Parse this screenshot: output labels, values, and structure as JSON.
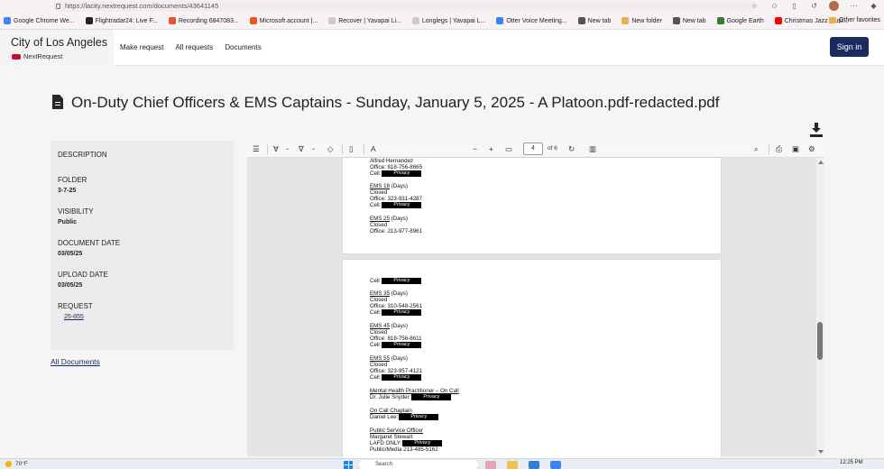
{
  "browser": {
    "url": "https://lacity.nextrequest.com/documents/43641145",
    "bookmarks": [
      {
        "label": "Google Chrome We...",
        "color": "#4285f4"
      },
      {
        "label": "Flightradar24: Live F...",
        "color": "#222222"
      },
      {
        "label": "Recording 6847083...",
        "color": "#e8542f"
      },
      {
        "label": "Microsoft account |...",
        "color": "#f25022"
      },
      {
        "label": "Recover | Yavapai Li...",
        "color": "#cccccc"
      },
      {
        "label": "Longlegs | Yavapai L...",
        "color": "#cccccc"
      },
      {
        "label": "Otter Voice Meeting...",
        "color": "#3b82f6"
      },
      {
        "label": "New tab",
        "color": "#555555"
      },
      {
        "label": "New folder",
        "color": "#e8b04a"
      },
      {
        "label": "New tab",
        "color": "#555555"
      },
      {
        "label": "Google Earth",
        "color": "#2e7d32"
      },
      {
        "label": "Christmas Jazz Musi...",
        "color": "#ff0000"
      }
    ],
    "other_favorites": "Other favorites"
  },
  "site": {
    "city": "City of Los Angeles",
    "logo_text": "NextRequest",
    "nav": [
      "Make request",
      "All requests",
      "Documents"
    ],
    "sign_in": "Sign in"
  },
  "document": {
    "title": "On-Duty Chief Officers & EMS Captains - Sunday, January 5, 2025 - A Platoon.pdf-redacted.pdf"
  },
  "sidebar": {
    "description_label": "DESCRIPTION",
    "folder_label": "FOLDER",
    "folder_value": "3-7-25",
    "visibility_label": "VISIBILITY",
    "visibility_value": "Public",
    "document_date_label": "DOCUMENT DATE",
    "document_date_value": "03/05/25",
    "upload_date_label": "UPLOAD DATE",
    "upload_date_value": "03/05/25",
    "request_label": "REQUEST",
    "request_value": "25-855",
    "all_documents": "All Documents"
  },
  "viewer": {
    "page_number": "4",
    "page_of": "of 6",
    "redaction_label": "Privacy",
    "page_a": {
      "line1": "Alfred Hernandez",
      "line2": "Office: 818-756-8665",
      "cell1": "Cell:",
      "ems18": "EMS 18",
      "ems18_days": " (Days)",
      "ems18_status": "Closed",
      "ems18_office": "Office: 323-931-4287",
      "cell2": "Cell:",
      "ems25": "EMS 25",
      "ems25_days": " (Days)",
      "ems25_status": "Closed",
      "ems25_office": "Office: 213-977-8961"
    },
    "page_b": {
      "cell_top": "Cell:",
      "ems35": "EMS 35",
      "ems35_days": " (Days)",
      "ems35_status": "Closed",
      "ems35_office": "Office: 310-548-2561",
      "ems35_cell": "Cell:",
      "ems45": "EMS 45",
      "ems45_days": " (Days)",
      "ems45_status": "Closed",
      "ems45_office": "Office: 818-756-8611",
      "ems45_cell": "Cell:",
      "ems55": "EMS 55",
      "ems55_days": " (Days)",
      "ems55_status": "Closed",
      "ems55_office": "Office: 323-957-4121",
      "ems55_cell": "Cell:",
      "mhp_title": "Mental Health Practitioner – On Call",
      "mhp_name": "Dr. Julie Snyder:",
      "chaplain_title": "On Call Chaplain",
      "chaplain_name": "Daniel Lee:",
      "pso_title": "Public Service Officer",
      "pso_name": "Margaret Stewart",
      "pso_lafd": "LAFD ONLY:",
      "pso_public": "Public/Media 213-485-5162"
    }
  },
  "taskbar": {
    "weather": "70°F",
    "search": "Search",
    "time": "12:25 PM"
  }
}
